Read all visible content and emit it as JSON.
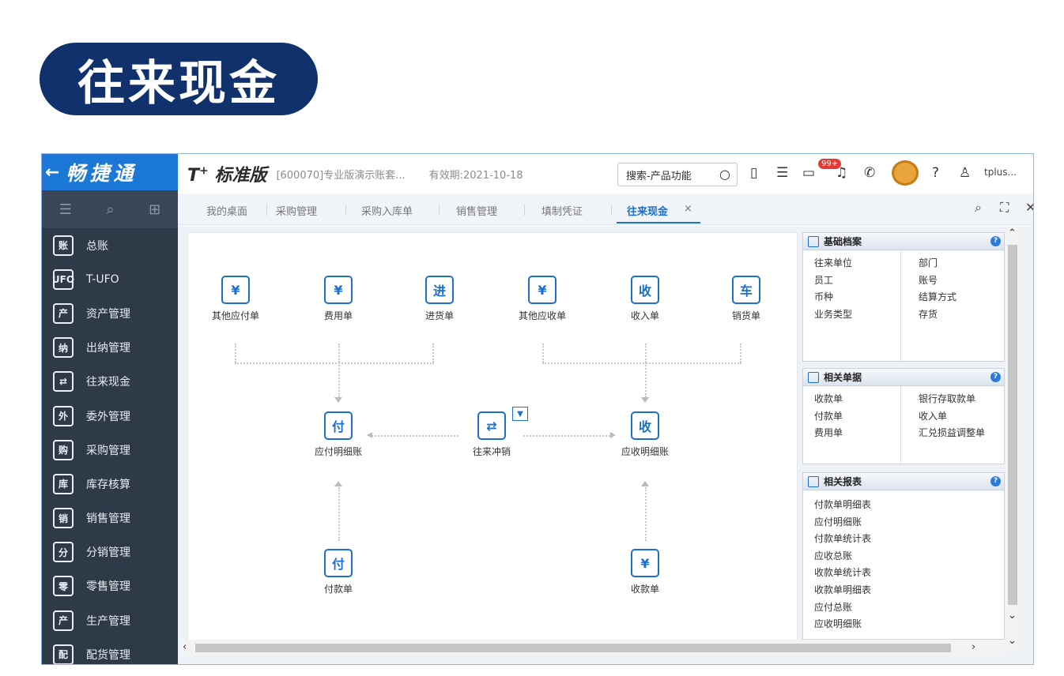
{
  "banner": {
    "title": "往来现金"
  },
  "sidebar": {
    "brand": "畅捷通",
    "back_icon": "←",
    "tools": [
      "menu-icon",
      "search-icon",
      "add-icon"
    ],
    "items": [
      {
        "label": "总账",
        "icon": "账"
      },
      {
        "label": "T-UFO",
        "icon": "UFO"
      },
      {
        "label": "资产管理",
        "icon": "产"
      },
      {
        "label": "出纳管理",
        "icon": "纳"
      },
      {
        "label": "往来现金",
        "icon": "⇄"
      },
      {
        "label": "委外管理",
        "icon": "外"
      },
      {
        "label": "采购管理",
        "icon": "购"
      },
      {
        "label": "库存核算",
        "icon": "库"
      },
      {
        "label": "销售管理",
        "icon": "销"
      },
      {
        "label": "分销管理",
        "icon": "分"
      },
      {
        "label": "零售管理",
        "icon": "零"
      },
      {
        "label": "生产管理",
        "icon": "产"
      },
      {
        "label": "配货管理",
        "icon": "配"
      }
    ]
  },
  "topbar": {
    "logo": "T",
    "logo_sup": "+",
    "logo_text": "标准版",
    "account": "[600070]专业版演示账套...",
    "valid_until": "有效期:2021-10-18",
    "search_placeholder": "搜索-产品功能",
    "badge": "99+",
    "user": "tplus..."
  },
  "tabs": [
    "我的桌面",
    "采购管理",
    "采购入库单",
    "销售管理",
    "填制凭证",
    "往来现金"
  ],
  "tab_close": "×",
  "flow": {
    "top_nodes": [
      {
        "label": "其他应付单",
        "icon": "¥"
      },
      {
        "label": "费用单",
        "icon": "¥"
      },
      {
        "label": "进货单",
        "icon": "进"
      },
      {
        "label": "其他应收单",
        "icon": "¥"
      },
      {
        "label": "收入单",
        "icon": "收"
      },
      {
        "label": "销货单",
        "icon": "车"
      }
    ],
    "mid_nodes": [
      {
        "label": "应付明细账",
        "icon": "付"
      },
      {
        "label": "往来冲销",
        "icon": "⇄"
      },
      {
        "label": "应收明细账",
        "icon": "收"
      }
    ],
    "bottom_nodes": [
      {
        "label": "付款单",
        "icon": "付"
      },
      {
        "label": "收款单",
        "icon": "¥"
      }
    ],
    "dropdown": "▼"
  },
  "panels": [
    {
      "title": "基础档案",
      "left": [
        "往来单位",
        "员工",
        "币种",
        "业务类型"
      ],
      "right": [
        "部门",
        "账号",
        "结算方式",
        "存货"
      ]
    },
    {
      "title": "相关单据",
      "left": [
        "收款单",
        "付款单",
        "费用单"
      ],
      "right": [
        "银行存取款单",
        "收入单",
        "汇兑损益调整单"
      ]
    },
    {
      "title": "相关报表",
      "left": [
        "付款单明细表",
        "应付明细账",
        "付款单统计表",
        "应收总账",
        "收款单统计表",
        "收款单明细表",
        "应付总账",
        "应收明细账"
      ],
      "right": []
    }
  ],
  "help_icon": "?",
  "colors": {
    "brand_blue": "#1c78d6",
    "banner": "#10316b",
    "sidebar": "#2f3a48",
    "accent": "#1c6fd0",
    "badge": "#e53935"
  }
}
